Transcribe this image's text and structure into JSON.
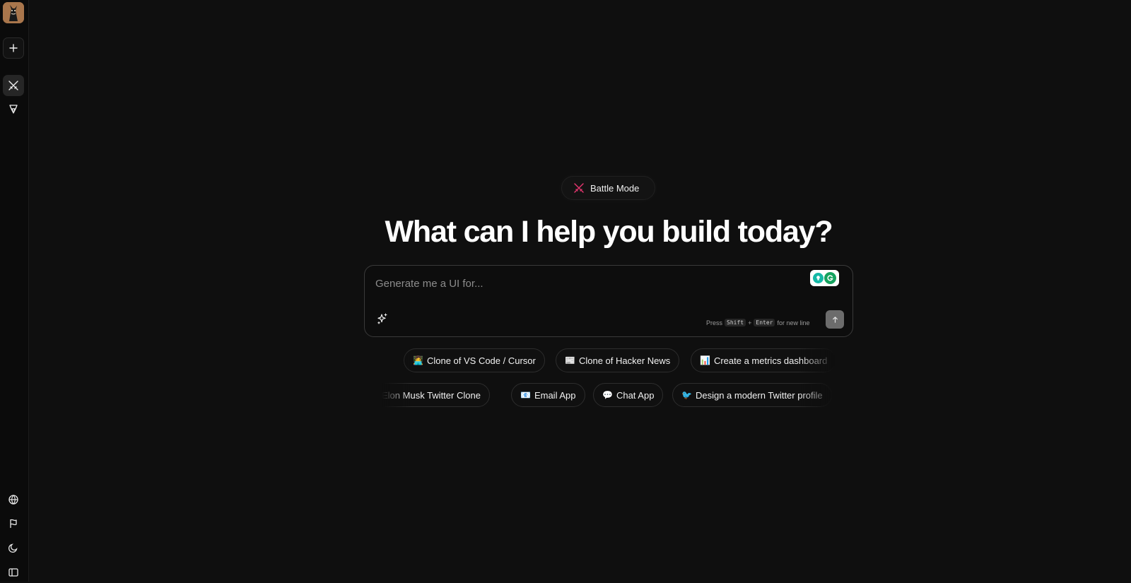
{
  "sidebar": {
    "icons": [
      "avatar",
      "plus-icon",
      "battle-swords-icon",
      "arena-icon",
      "globe-icon",
      "flag-icon",
      "moon-icon",
      "sidebar-panel-icon"
    ]
  },
  "mode_pill": {
    "label": "Battle Mode",
    "accent": "#e0356d"
  },
  "headline": "What can I help you build today?",
  "prompt": {
    "placeholder": "Generate me a UI for...",
    "value": "",
    "hint_prefix": "Press",
    "hint_key1": "Shift",
    "hint_plus": "+",
    "hint_key2": "Enter",
    "hint_suffix": "for new line"
  },
  "suggestions": {
    "row1": [
      {
        "emoji": "👩‍💻",
        "label": "Clone of VS Code / Cursor"
      },
      {
        "emoji": "📰",
        "label": "Clone of Hacker News"
      },
      {
        "emoji": "📊",
        "label": "Create a metrics dashboard"
      }
    ],
    "row2": [
      {
        "emoji": "",
        "label": "Elon Musk Twitter Clone"
      },
      {
        "emoji": "📧",
        "label": "Email App"
      },
      {
        "emoji": "💬",
        "label": "Chat App"
      },
      {
        "emoji": "🐦",
        "label": "Design a modern Twitter profile"
      }
    ]
  }
}
